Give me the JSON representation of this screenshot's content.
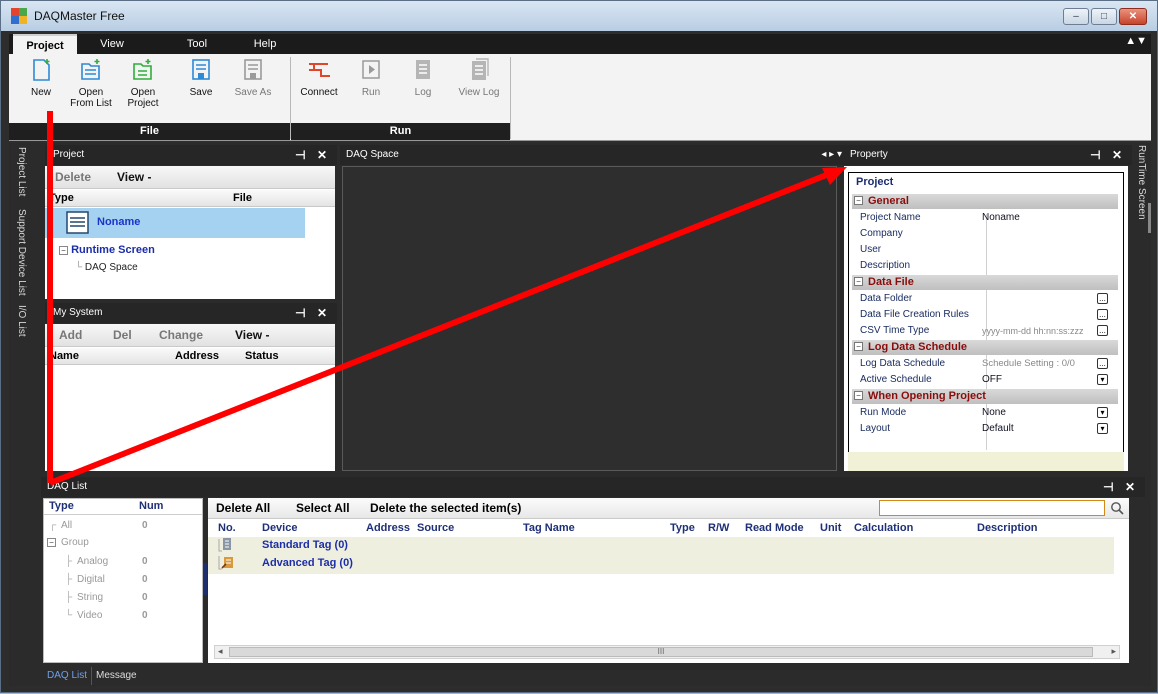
{
  "app": {
    "title": "DAQMaster Free"
  },
  "menu": {
    "items": [
      "Project",
      "View",
      "Tool",
      "Help"
    ],
    "active": "Project",
    "toggle": "▲▼"
  },
  "ribbon": {
    "new": "New",
    "open_from_list_1": "Open",
    "open_from_list_2": "From List",
    "open_project_1": "Open",
    "open_project_2": "Project",
    "save": "Save",
    "save_as": "Save As",
    "connect": "Connect",
    "run": "Run",
    "log": "Log",
    "view_log": "View Log",
    "group_file": "File",
    "group_run": "Run"
  },
  "side_tabs": {
    "project_list": "Project List",
    "support_device_list": "Support Device List",
    "io_list": "I/O List",
    "runtime_screen": "RunTime Screen"
  },
  "project_panel": {
    "title": "Project",
    "delete": "Delete",
    "view": "View -",
    "col_type": "Type",
    "col_file": "File",
    "noname": "Noname",
    "runtime_screen": "Runtime Screen",
    "daq_space": "DAQ Space"
  },
  "my_system": {
    "title": "My System",
    "add": "Add",
    "del": "Del",
    "change": "Change",
    "view": "View -",
    "col_name": "Name",
    "col_address": "Address",
    "col_status": "Status"
  },
  "daq_space": {
    "title": "DAQ Space",
    "nav": "◂ ▸ ▾"
  },
  "property": {
    "title": "Property",
    "object": "Project",
    "categories": [
      {
        "name": "General",
        "rows": [
          {
            "k": "Project Name",
            "v": "Noname"
          },
          {
            "k": "Company",
            "v": ""
          },
          {
            "k": "User",
            "v": ""
          },
          {
            "k": "Description",
            "v": ""
          }
        ]
      },
      {
        "name": "Data File",
        "rows": [
          {
            "k": "Data Folder",
            "v": "",
            "btn": "..."
          },
          {
            "k": "Data File Creation Rules",
            "v": "",
            "btn": "..."
          },
          {
            "k": "CSV Time Type",
            "v": "yyyy-mm-dd hh:nn:ss:zzz",
            "btn": "..."
          }
        ]
      },
      {
        "name": "Log Data Schedule",
        "rows": [
          {
            "k": "Log Data Schedule",
            "v": "Schedule Setting : 0/0",
            "btn": "..."
          },
          {
            "k": "Active Schedule",
            "v": "OFF",
            "btn": "▾"
          }
        ]
      },
      {
        "name": "When Opening Project",
        "rows": [
          {
            "k": "Run Mode",
            "v": "None",
            "btn": "▾"
          },
          {
            "k": "Layout",
            "v": "Default",
            "btn": "▾"
          }
        ]
      }
    ]
  },
  "daq_list": {
    "title": "DAQ List",
    "side_col_type": "Type",
    "side_col_num": "Num",
    "side_rows": [
      {
        "label": "All",
        "num": "0"
      },
      {
        "label": "Group",
        "num": ""
      },
      {
        "label": "Analog",
        "num": "0"
      },
      {
        "label": "Digital",
        "num": "0"
      },
      {
        "label": "String",
        "num": "0"
      },
      {
        "label": "Video",
        "num": "0"
      }
    ],
    "delete_all": "Delete All",
    "select_all": "Select All",
    "delete_selected": "Delete the selected item(s)",
    "search_placeholder": "",
    "columns": [
      "No.",
      "Device",
      "Address",
      "Source",
      "Tag Name",
      "Type",
      "R/W",
      "Read Mode",
      "Unit",
      "Calculation",
      "Description"
    ],
    "standard_tag": "Standard Tag (0)",
    "advanced_tag": "Advanced Tag (0)",
    "scroll_mid": "III"
  },
  "bottom_tabs": [
    "DAQ List",
    "Message"
  ],
  "colors": {
    "accent": "#5b87d6",
    "arrow": "#ff0000",
    "dark": "#2b2b2b",
    "category_text": "#8a0d0d"
  }
}
